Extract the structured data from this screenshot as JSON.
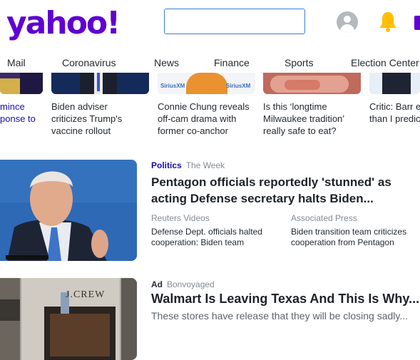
{
  "header": {
    "logo": "yahoo!",
    "search_placeholder": "",
    "search_value": ""
  },
  "nav": [
    "Mail",
    "Coronavirus",
    "News",
    "Finance",
    "Sports",
    "Election Center"
  ],
  "strip": [
    {
      "lines": [
        "mince",
        "ponse to"
      ]
    },
    {
      "lines": [
        "Biden adviser",
        "criticizes Trump's",
        "vaccine rollout"
      ]
    },
    {
      "lines": [
        "Connie Chung reveals",
        "off-cam drama with",
        "former co-anchor"
      ],
      "badge": "SiriusXM"
    },
    {
      "lines": [
        "Is this ‘longtime",
        "Milwaukee tradition’",
        "really safe to eat?"
      ]
    },
    {
      "lines": [
        "Critic: Barr e",
        "than I predic"
      ]
    }
  ],
  "story1": {
    "category": "Politics",
    "source": "The Week",
    "headline_lines": [
      "Pentagon officials reportedly 'stunned' as",
      "acting Defense secretary halts Biden..."
    ],
    "related": [
      {
        "source": "Reuters Videos",
        "lines": [
          "Defense Dept. officials halted",
          "cooperation: Biden team"
        ]
      },
      {
        "source": "Associated Press",
        "lines": [
          "Biden transition team criticizes",
          "cooperation from Pentagon"
        ]
      }
    ]
  },
  "story2": {
    "ad_label": "Ad",
    "source": "Bonvoyaged",
    "headline": "Walmart Is Leaving Texas And This Is Why...",
    "description": "These stores have release that they will be closing sadly...",
    "storefront_sign": "J.CREW"
  },
  "colors": {
    "brand": "#6001d2",
    "search_button": "#3a87e8",
    "bell": "#ffbe00",
    "category": "#1a0dab"
  }
}
